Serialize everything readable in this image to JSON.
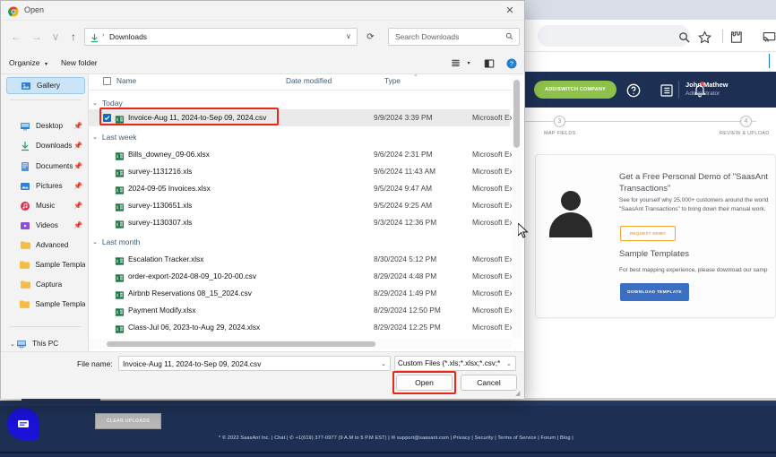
{
  "dialog": {
    "title": "Open",
    "app_icon": "chrome-icon",
    "close_label": "✕",
    "nav": {
      "back": "←",
      "forward": "→",
      "recent": "∨",
      "up": "↑",
      "address_path": "Downloads",
      "address_separator": "›",
      "address_dropdown": "∨",
      "refresh": "⟳",
      "search_placeholder": "Search Downloads",
      "search_icon": "search-icon"
    },
    "commandbar": {
      "organize": "Organize",
      "organize_caret": "▾",
      "new_folder": "New folder",
      "view_icon": "list-view-icon",
      "view_caret": "▾",
      "layout_icon": "preview-pane-icon",
      "help_icon": "help-icon"
    },
    "sidebar": {
      "gallery": {
        "label": "Gallery",
        "icon": "gallery-icon"
      },
      "items": [
        {
          "label": "Desktop",
          "icon": "desktop-icon",
          "pinned": true
        },
        {
          "label": "Downloads",
          "icon": "downloads-icon",
          "pinned": true
        },
        {
          "label": "Documents",
          "icon": "documents-icon",
          "pinned": true
        },
        {
          "label": "Pictures",
          "icon": "pictures-icon",
          "pinned": true
        },
        {
          "label": "Music",
          "icon": "music-icon",
          "pinned": true
        },
        {
          "label": "Videos",
          "icon": "videos-icon",
          "pinned": true
        },
        {
          "label": "Advanced",
          "icon": "folder-icon",
          "pinned": false
        },
        {
          "label": "Sample Templat",
          "icon": "folder-icon",
          "pinned": false
        },
        {
          "label": "Captura",
          "icon": "folder-icon",
          "pinned": false
        },
        {
          "label": "Sample Templat",
          "icon": "folder-icon",
          "pinned": false
        }
      ],
      "this_pc": {
        "label": "This PC",
        "icon": "this-pc-icon",
        "chevron": "⌄"
      }
    },
    "columns": {
      "name": "Name",
      "date_modified": "Date modified",
      "type": "Type",
      "sort_caret": "⌄"
    },
    "groups": [
      {
        "label": "Today",
        "chevron": "⌄",
        "files": [
          {
            "name": "Invoice-Aug 11, 2024-to-Sep 09, 2024.csv",
            "date": "9/9/2024 3:39 PM",
            "type": "Microsoft Excel",
            "icon": "excel-csv-icon",
            "selected": true,
            "checked": true
          }
        ]
      },
      {
        "label": "Last week",
        "chevron": "⌄",
        "files": [
          {
            "name": "Bills_downey_09-06.xlsx",
            "date": "9/6/2024 2:31 PM",
            "type": "Microsoft Excel",
            "icon": "excel-xlsx-icon",
            "selected": false,
            "checked": false
          },
          {
            "name": "survey-1131216.xls",
            "date": "9/6/2024 11:43 AM",
            "type": "Microsoft Excel",
            "icon": "excel-xls-icon",
            "selected": false,
            "checked": false
          },
          {
            "name": "2024-09-05 Invoices.xlsx",
            "date": "9/5/2024 9:47 AM",
            "type": "Microsoft Excel",
            "icon": "excel-xlsx-icon",
            "selected": false,
            "checked": false
          },
          {
            "name": "survey-1130651.xls",
            "date": "9/5/2024 9:25 AM",
            "type": "Microsoft Excel",
            "icon": "excel-xls-icon",
            "selected": false,
            "checked": false
          },
          {
            "name": "survey-1130307.xls",
            "date": "9/3/2024 12:36 PM",
            "type": "Microsoft Excel",
            "icon": "excel-xls-icon",
            "selected": false,
            "checked": false
          }
        ]
      },
      {
        "label": "Last month",
        "chevron": "⌄",
        "files": [
          {
            "name": "Escalation Tracker.xlsx",
            "date": "8/30/2024 5:12 PM",
            "type": "Microsoft Excel",
            "icon": "excel-xlsx-icon",
            "selected": false,
            "checked": false
          },
          {
            "name": "order-export-2024-08-09_10-20-00.csv",
            "date": "8/29/2024 4:48 PM",
            "type": "Microsoft Excel",
            "icon": "excel-csv-icon",
            "selected": false,
            "checked": false
          },
          {
            "name": "Airbnb Reservations 08_15_2024.csv",
            "date": "8/29/2024 1:49 PM",
            "type": "Microsoft Excel",
            "icon": "excel-csv-icon",
            "selected": false,
            "checked": false
          },
          {
            "name": "Payment Modify.xlsx",
            "date": "8/29/2024 12:50 PM",
            "type": "Microsoft Excel",
            "icon": "excel-xlsx-icon",
            "selected": false,
            "checked": false
          },
          {
            "name": "Class-Jul 06, 2023-to-Aug 29, 2024.xlsx",
            "date": "8/29/2024 12:25 PM",
            "type": "Microsoft Excel",
            "icon": "excel-xlsx-icon",
            "selected": false,
            "checked": false
          }
        ]
      }
    ],
    "footer": {
      "file_name_label": "File name:",
      "file_name_value": "Invoice-Aug 11, 2024-to-Sep 09, 2024.csv",
      "file_name_chevron": "⌄",
      "file_type_value": "Custom Files (*.xls;*.xlsx;*.csv;*",
      "file_type_chevron": "⌄",
      "open_label": "Open",
      "cancel_label": "Cancel"
    }
  },
  "browser": {
    "zoom_icon": "zoom-icon",
    "bookmark_icon": "star-icon",
    "extensions_icon": "puzzle-piece-icon",
    "cast_icon": "cast-icon"
  },
  "app": {
    "nav": {
      "add_switch_company": "ADD/SWITCH COMPANY",
      "help_icon": "question-mark-icon",
      "tasks_icon": "list-icon",
      "notifications_icon": "bell-icon",
      "user_name": "John Mathew",
      "user_role": "Administrator"
    },
    "stepper": {
      "steps": [
        {
          "number": "3",
          "label": "MAP FIELDS"
        },
        {
          "number": "4",
          "label": "REVIEW & UPLOAD"
        }
      ]
    },
    "demo_card": {
      "avatar_icon": "person-avatar-icon",
      "title": "Get a Free Personal Demo of \"SaasAnt Transactions\"",
      "body": "See for yourself why 25,000+ customers around the world \"SaasAnt Transactions\" to bring down their manual work.",
      "request_demo_button": "REQUEST DEMO",
      "templates_title": "Sample Templates",
      "templates_body": "For best mapping experience, please download our samp",
      "download_template_button": "DOWNLOAD TEMPLATE"
    },
    "bottom": {
      "chat_icon": "chat-bubble-icon",
      "clear_uploads": "CLEAR UPLOADS"
    },
    "footer_text": "* © 2022 SaasAnt Inc.  | Chat | ✆ +1(619) 377-0977 (9 A.M to 5 P.M EST)  | ✉ support@saasant.com | Privacy | Security | Terms of Service | Forum | Blog |"
  },
  "colors": {
    "app_navy": "#1d3054",
    "accent_green": "#8ec14a",
    "accent_blue": "#3a6fc4",
    "accent_orange": "#f0a32e",
    "highlight_red": "#e8271b",
    "selection_blue": "#cce4f7"
  }
}
